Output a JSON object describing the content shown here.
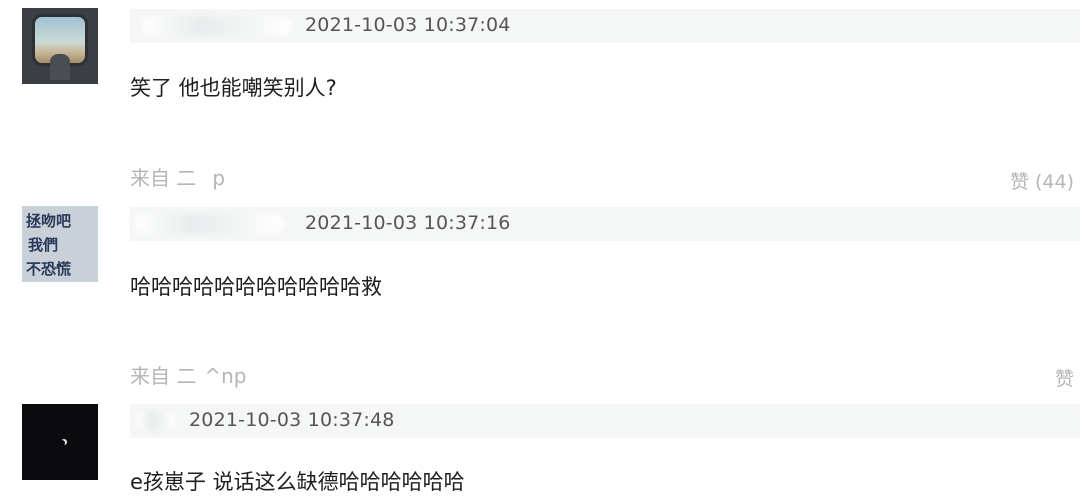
{
  "comments": [
    {
      "timestamp": "2021-10-03 10:37:04",
      "text": "笑了 他也能嘲笑别人?",
      "source": "来自 二    p",
      "like": "赞 (44)"
    },
    {
      "timestamp": "2021-10-03 10:37:16",
      "text": "哈哈哈哈哈哈哈哈哈哈哈救",
      "source": "来自 二  ^np",
      "like": "赞",
      "avatar_text": [
        "拯吻吧",
        "我們",
        "不恐慌"
      ]
    },
    {
      "timestamp": "2021-10-03 10:37:48",
      "text": "e孩崽子 说话这么缺德哈哈哈哈哈哈"
    }
  ]
}
